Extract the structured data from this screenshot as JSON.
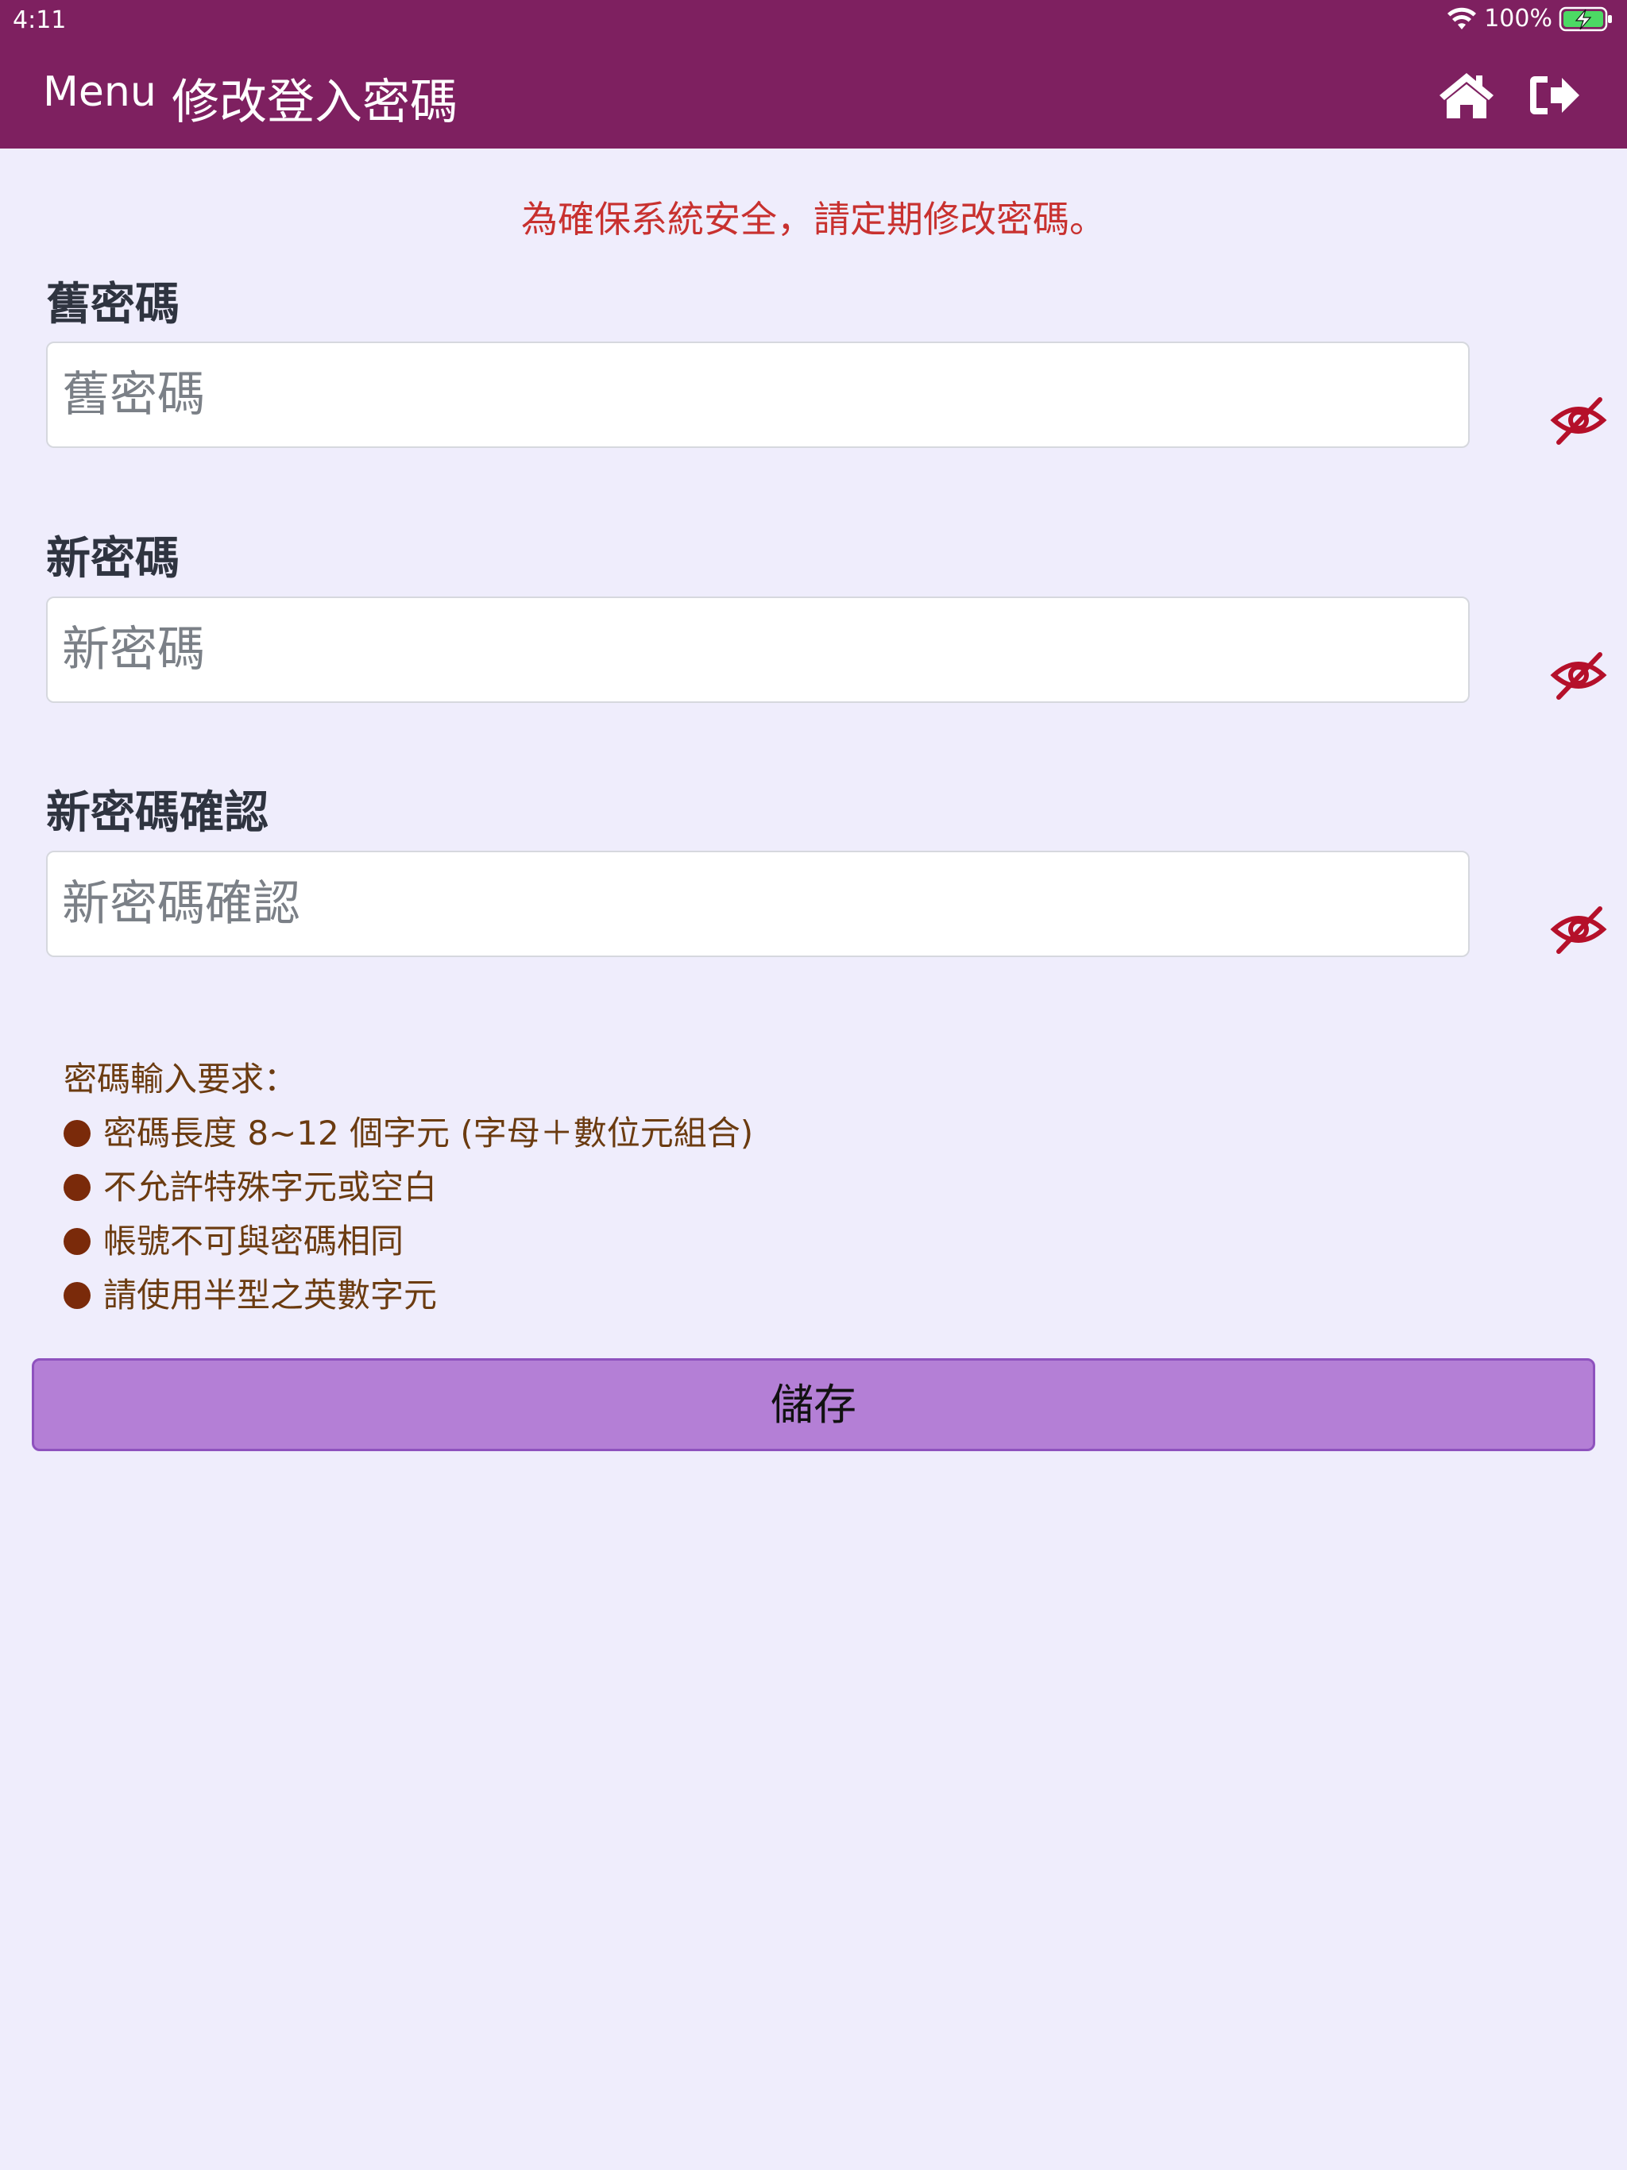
{
  "status_bar": {
    "time": "4:11",
    "battery": "100%"
  },
  "nav": {
    "menu_label": "Menu",
    "title": "修改登入密碼",
    "icons": {
      "home": "home-icon",
      "logout": "sign-out-icon"
    }
  },
  "notice": "為確保系統安全，請定期修改密碼。",
  "fields": [
    {
      "label": "舊密碼",
      "placeholder": "舊密碼",
      "value": ""
    },
    {
      "label": "新密碼",
      "placeholder": "新密碼",
      "value": ""
    },
    {
      "label": "新密碼確認",
      "placeholder": "新密碼確認",
      "value": ""
    }
  ],
  "requirements": {
    "title": "密碼輸入要求：",
    "items": [
      "密碼長度 8~12 個字元 (字母＋數位元組合)",
      "不允許特殊字元或空白",
      "帳號不可與密碼相同",
      "請使用半型之英數字元"
    ]
  },
  "save_label": "儲存",
  "colors": {
    "header": "#7e2060",
    "background": "#efedfc",
    "notice": "#c8312f",
    "eye_icon": "#b5102a",
    "save_button": "#b47fd6",
    "requirements_text": "#6b3b10"
  }
}
